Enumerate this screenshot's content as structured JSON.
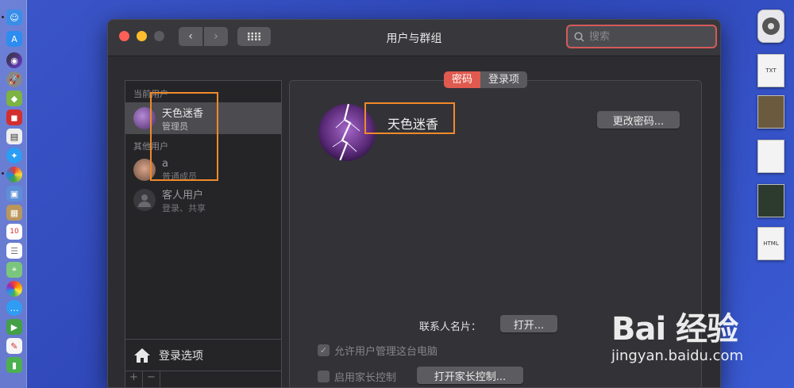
{
  "window": {
    "title": "用户与群组",
    "search_placeholder": "搜索"
  },
  "sidebar": {
    "current_users_label": "当前用户",
    "other_users_label": "其他用户",
    "users": [
      {
        "name": "天色迷香",
        "role": "管理员"
      },
      {
        "name": "a",
        "role": "普通成员"
      },
      {
        "name": "客人用户",
        "role": "登录、共享"
      }
    ],
    "login_options": "登录选项",
    "bottom_buttons": [
      "+",
      "−"
    ]
  },
  "tabs": [
    {
      "label": "密码",
      "active": true
    },
    {
      "label": "登录项",
      "active": false
    }
  ],
  "main": {
    "user_name": "天色迷香",
    "change_password_button": "更改密码...",
    "contact_card_label": "联系人名片：",
    "open_button": "打开...",
    "allow_admin_label": "允许用户管理这台电脑",
    "allow_admin_checked": true,
    "parental_controls_label": "启用家长控制",
    "parental_controls_checked": false,
    "open_parental_button": "打开家长控制..."
  },
  "desktop_icons": [
    "TXT",
    "",
    "",
    "",
    "HTML"
  ],
  "dock_icons": [
    "finder-icon",
    "app-store-icon",
    "siri-icon",
    "launchpad-icon",
    "android-icon",
    "app-icon",
    "calendar-icon",
    "safari-icon",
    "chrome-icon",
    "preview-icon",
    "notes-icon",
    "calendar-date-icon",
    "reminders-icon",
    "maps-icon",
    "photos-icon",
    "messages-icon",
    "facetime-icon",
    "textedit-icon",
    "numbers-icon"
  ],
  "dock_calendar_day": "10",
  "watermark": {
    "brand": "Bai 经验",
    "site": "jingyan.baidu.com"
  },
  "colors": {
    "accent_red": "#e05a4f",
    "highlight_orange": "#f08a2a",
    "desktop_blue": "#3b56c9"
  }
}
